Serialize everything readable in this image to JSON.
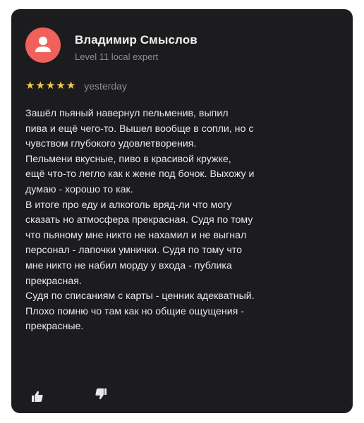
{
  "review": {
    "author": "Владимир Смыслов",
    "author_level": "Level 11 local expert",
    "rating": 5,
    "date": "yesterday",
    "text_lines": [
      "Зашёл пьяный навернул пельменив, выпил",
      "пива и ещё чего-то. Вышел вообще в сопли, но с",
      "чувством глубокого удовлетворения.",
      "Пельмени вкусные, пиво в красивой кружке,",
      "ещё что-то легло как к жене под бочок. Выхожу и",
      "думаю - хорошо то как.",
      "В итоге про еду и алкоголь вряд-ли что могу",
      "сказать но атмосфера прекрасная. Судя по тому",
      "что пьяному мне никто не нахамил и не выгнал",
      "персонал - лапочки умнички. Судя по тому что",
      "мне никто не набил морду у входа - публика",
      "прекрасная.",
      "Судя по списаниям с карты - ценник адекватный.",
      "Плохо помню чо там как но общие ощущения -",
      "прекрасные."
    ]
  },
  "icons": {
    "avatar": "user-icon",
    "rating_star": "star-icon",
    "like": "thumbs-up-icon",
    "dislike": "thumbs-down-icon"
  },
  "colors": {
    "card_background": "#1c1c1e",
    "avatar": "#f1605a",
    "star": "#f2c94c",
    "text": "#e8e8ea",
    "secondary_text": "#8d8d92"
  }
}
